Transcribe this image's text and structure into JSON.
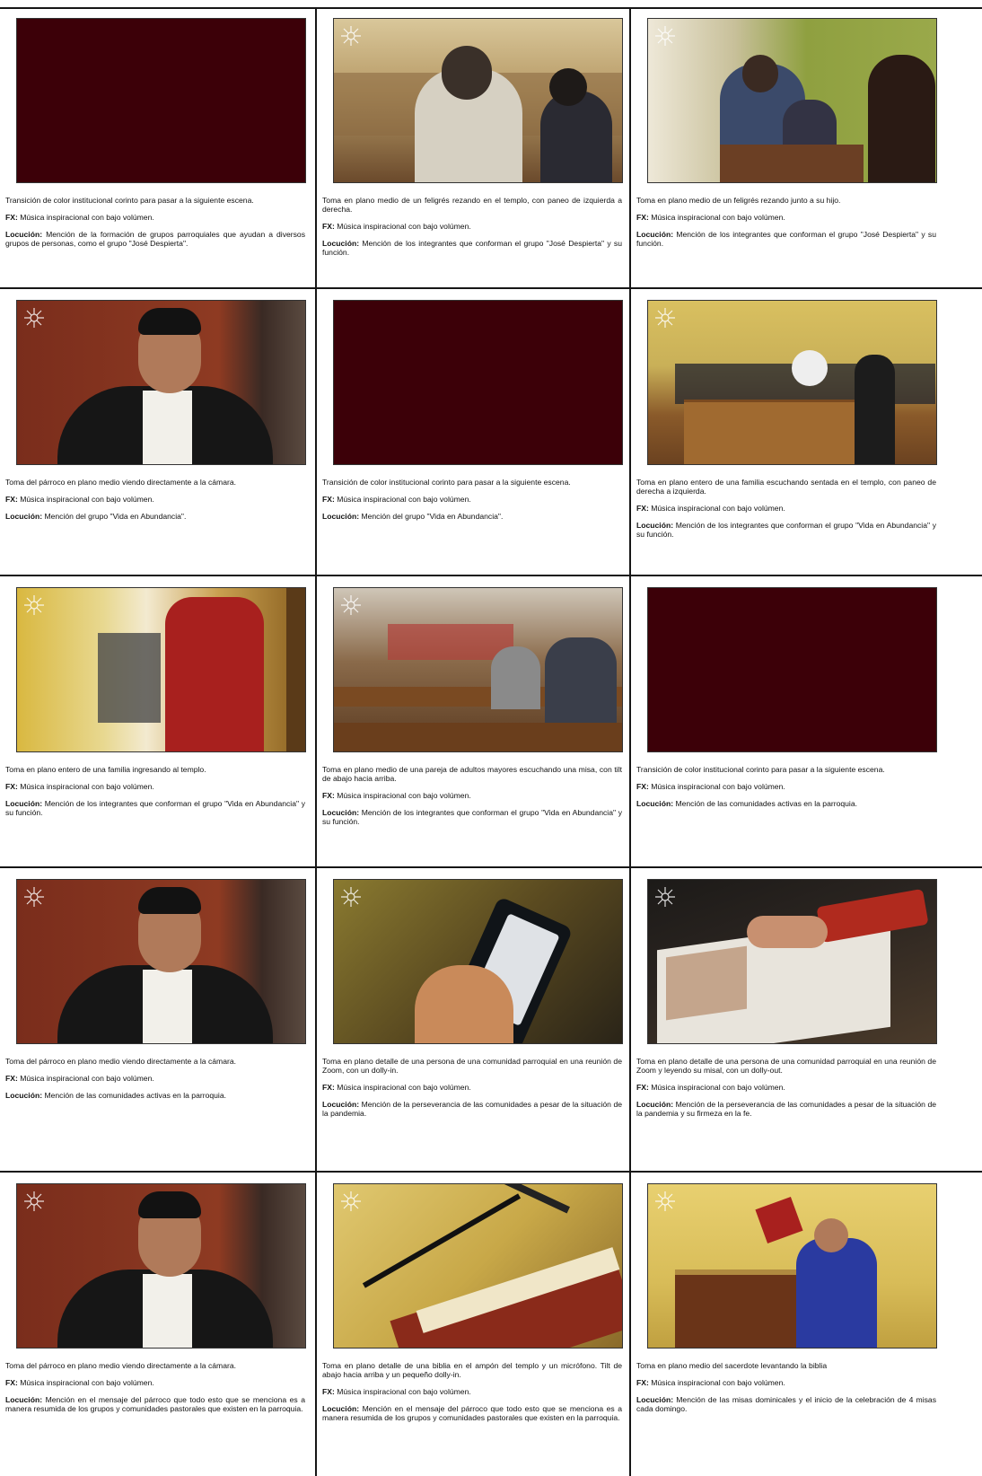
{
  "labels": {
    "fx": "FX:",
    "locucion": "Locución:"
  },
  "colors": {
    "corinto": "#3c0008"
  },
  "scenes": [
    {
      "shot": "Transición de color institucional corinto para pasar a la siguiente escena.",
      "fx": "Música inspiracional con bajo volúmen.",
      "locucion": "Mención de la formación de grupos parroquiales que ayudan a diversos grupos de personas, como el grupo \"José Despierta\"."
    },
    {
      "shot": "Toma en plano medio de un feligrés rezando en el templo, con paneo de izquierda a derecha.",
      "fx": "Música inspiracional con bajo volúmen.",
      "locucion": "Mención de los integrantes que conforman el grupo \"José Despierta\" y su función."
    },
    {
      "shot": "Toma en plano medio de un feligrés rezando junto a su hijo.",
      "fx": "Música inspiracional con bajo volúmen.",
      "locucion": "Mención de los integrantes que conforman el grupo \"José Despierta\" y su función."
    },
    {
      "shot": "Toma del párroco en plano medio viendo directamente a la cámara.",
      "fx": "Música inspiracional con bajo volúmen.",
      "locucion": "Mención del grupo \"Vida en Abundancia\"."
    },
    {
      "shot": "Transición de color institucional corinto para pasar a la siguiente escena.",
      "fx": "Música inspiracional con bajo volúmen.",
      "locucion": "Mención del grupo \"Vida en Abundancia\"."
    },
    {
      "shot": "Toma en plano entero de una familia escuchando sentada en el templo, con paneo de derecha a izquierda.",
      "fx": "Música inspiracional con bajo volúmen.",
      "locucion": "Mención de los integrantes que conforman el grupo \"Vida en Abundancia\" y su función."
    },
    {
      "shot": "Toma en plano entero de una familia ingresando al templo.",
      "fx": "Música inspiracional con bajo volúmen.",
      "locucion": "Mención de los integrantes que conforman el grupo \"Vida en Abundancia\" y su función."
    },
    {
      "shot": "Toma en plano medio de una pareja de adultos mayores escuchando una misa, con tilt de abajo hacia arriba.",
      "fx": "Música inspiracional con bajo volúmen.",
      "locucion": "Mención de los integrantes que conforman el grupo \"Vida en Abundancia\" y su función."
    },
    {
      "shot": "Transición de color institucional corinto para pasar a la siguiente escena.",
      "fx": "Música inspiracional con bajo volúmen.",
      "locucion": "Mención de las comunidades activas en la parroquia."
    },
    {
      "shot": "Toma del párroco en plano medio viendo directamente a la cámara.",
      "fx": "Música inspiracional con bajo volúmen.",
      "locucion": "Mención de las comunidades activas en la parroquia."
    },
    {
      "shot": "Toma en plano detalle de una persona de una comunidad parroquial en una reunión de Zoom, con un dolly-in.",
      "fx": "Música inspiracional con bajo volúmen.",
      "locucion": "Mención de la perseverancia de las comunidades a pesar de la situación de la pandemia."
    },
    {
      "shot": "Toma en plano detalle de una persona de una comunidad parroquial en una reunión de Zoom y leyendo su misal, con un dolly-out.",
      "fx": "Música inspiracional con bajo volúmen.",
      "locucion": "Mención de la perseverancia de las comunidades a pesar de la situación de la pandemia y su firmeza en la fe."
    },
    {
      "shot": "Toma del párroco en plano medio viendo directamente a la cámara.",
      "fx": "Música inspiracional con bajo volúmen.",
      "locucion": "Mención en el mensaje del párroco que todo esto que se menciona es a manera resumida de los grupos y comunidades pastorales que existen en la parroquia."
    },
    {
      "shot": "Toma en plano detalle de una biblia en el ampón del templo y un micrófono. Tilt de abajo hacia arriba y un pequeño dolly-in.",
      "fx": "Música inspiracional con bajo volúmen.",
      "locucion": "Mención en el mensaje del párroco que todo esto que se menciona es a manera resumida de los grupos y comunidades pastorales que existen en la parroquia."
    },
    {
      "shot": "Toma en plano medio del sacerdote levantando la biblia",
      "fx": "Música inspiracional con bajo volúmen.",
      "locucion": "Mención de las misas dominicales y el inicio de la celebración de 4 misas cada domingo."
    }
  ]
}
